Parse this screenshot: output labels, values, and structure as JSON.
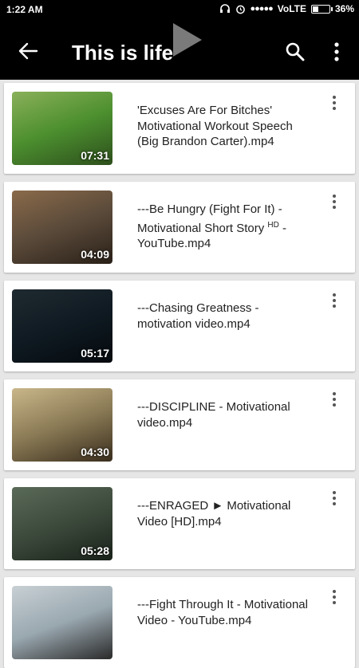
{
  "status": {
    "time": "1:22 AM",
    "network": "VoLTE",
    "battery_percent": "36%",
    "battery_level": 0.36
  },
  "app_bar": {
    "title": "This is life"
  },
  "videos": [
    {
      "title": "'Excuses Are For Bitches' Motivational Workout Speech (Big Brandon Carter).mp4",
      "duration": "07:31",
      "thumb_colors": [
        "#4c8f2f",
        "#8ab05a",
        "#2d4f1c"
      ]
    },
    {
      "title": "---Be Hungry (Fight For It) - Motivational Short Story",
      "title_sup": "HD",
      "title_suffix": " - YouTube.mp4",
      "duration": "04:09",
      "thumb_colors": [
        "#5a4a3a",
        "#8a6a4a",
        "#2a2018"
      ]
    },
    {
      "title": "---Chasing Greatness - motivation video.mp4",
      "duration": "05:17",
      "thumb_colors": [
        "#0f1a22",
        "#1f2a30",
        "#050a0e"
      ]
    },
    {
      "title": "---DISCIPLINE - Motivational video.mp4",
      "duration": "04:30",
      "thumb_colors": [
        "#8a7a55",
        "#c9b78a",
        "#3a2e1e"
      ]
    },
    {
      "title": "---ENRAGED ► Motivational Video [HD].mp4",
      "duration": "05:28",
      "thumb_colors": [
        "#3c4a3c",
        "#5a6a58",
        "#1a221a"
      ]
    },
    {
      "title": "---Fight Through It - Motivational Video - YouTube.mp4",
      "duration": "",
      "thumb_colors": [
        "#9aa8b0",
        "#c8d0d4",
        "#2a2a2a"
      ]
    }
  ]
}
